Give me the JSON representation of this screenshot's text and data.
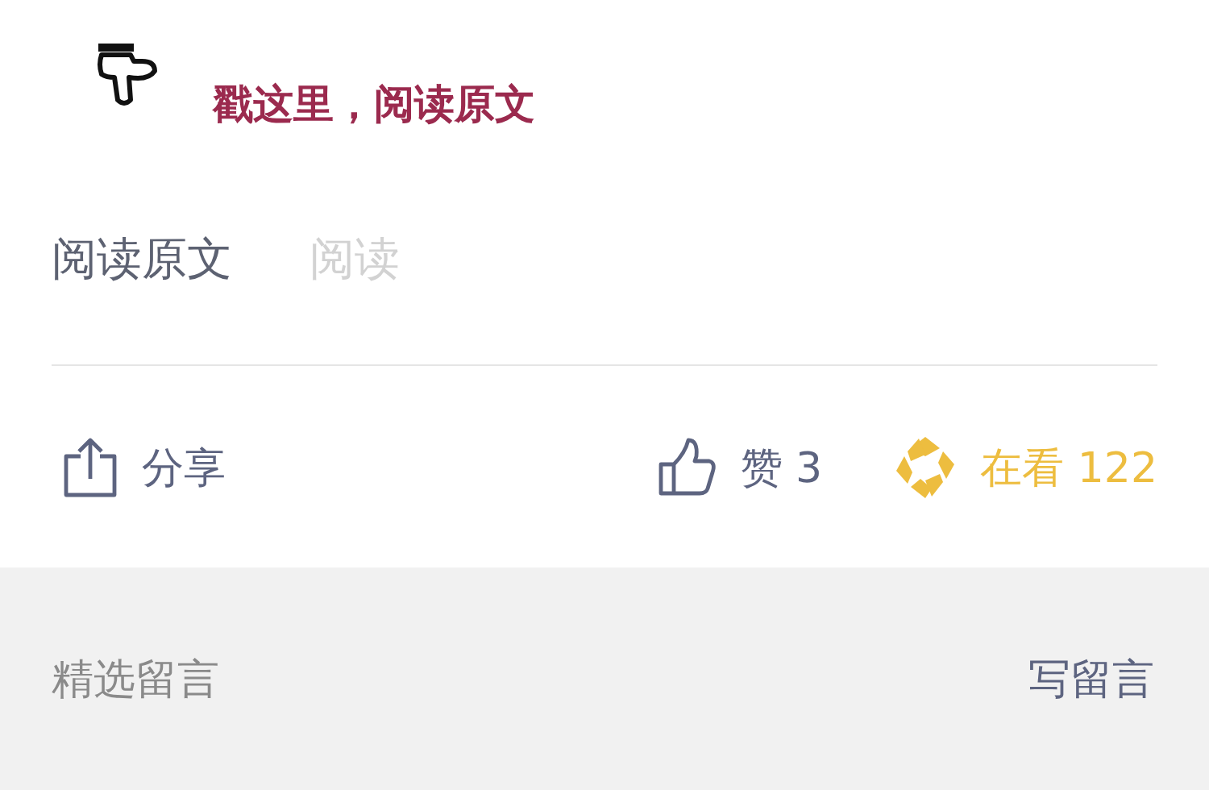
{
  "banner": {
    "text": "戳这里，阅读原文"
  },
  "read_original": {
    "label": "阅读原文",
    "faded_label": "阅读"
  },
  "actions": [
    {
      "kind": "share",
      "label": "分享",
      "selected": false
    },
    {
      "kind": "like",
      "label": "赞 3",
      "selected": false
    },
    {
      "kind": "watch",
      "label": "在看 122",
      "selected": true
    }
  ],
  "comments": {
    "title": "精选留言",
    "write": "写留言"
  }
}
